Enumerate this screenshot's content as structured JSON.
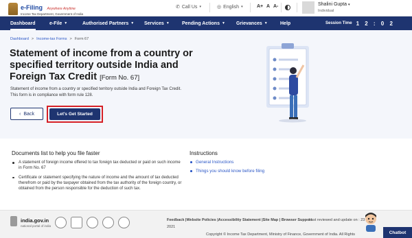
{
  "header": {
    "logo_title": "e-Filing",
    "logo_tagline": "Anywhere Anytime",
    "logo_sub": "Income Tax Department, Government of India",
    "call_us": "Call Us",
    "language": "English",
    "font_increase": "A+",
    "font_normal": "A",
    "font_decrease": "A-",
    "user_name": "Shalini Gupta",
    "user_role": "Individual"
  },
  "nav": {
    "items": [
      {
        "label": "Dashboard"
      },
      {
        "label": "e-File"
      },
      {
        "label": "Authorised Partners"
      },
      {
        "label": "Services"
      },
      {
        "label": "Pending Actions"
      },
      {
        "label": "Grievances"
      },
      {
        "label": "Help"
      }
    ],
    "session_label": "Session Time",
    "session_time": "1 2 : 0 2"
  },
  "breadcrumb": {
    "items": [
      "Dashboard",
      "Income-tax Forms",
      "Form 67"
    ],
    "separator": ">"
  },
  "page": {
    "title": "Statement of income from a country or specified territory outside India and Foreign Tax Credit",
    "form_no": "[Form No. 67]",
    "description": "Statement of income from a country or specified territory outside India and Foreign Tax Credit. This form is in compliance with form rule 128.",
    "back_label": "Back",
    "start_label": "Let's Get Started"
  },
  "documents": {
    "title": "Documents list to help you file faster",
    "items": [
      "A statement of foreign income offered to tax foreign tax deducted or paid on such income in Form No. 67",
      "Certificate or statement specifying the nature of income and the amount of tax deducted therefrom or paid by the taxpayer obtained from the tax authority of the foreign country, or obtained from the person responsible for the deduction of such tax."
    ]
  },
  "instructions": {
    "title": "Instructions",
    "items": [
      "General Instructions",
      "Things you should know before filing"
    ]
  },
  "footer": {
    "gov_site": "india.gov.in",
    "gov_sub": "national portal of india",
    "links": "Feedback |Website Policies |Accessibility Statement |Site Map | Browser Support",
    "last_updated": "Last reviewed and update on : 23",
    "year": "2021",
    "copyright": "Copyright © Income Tax Department, Ministry of Finance, Government of India. All Rights"
  },
  "chatbot": {
    "label": "Chatbot"
  },
  "colors": {
    "primary": "#1e3470",
    "highlight": "#d51f25",
    "link": "#2a56c6"
  }
}
